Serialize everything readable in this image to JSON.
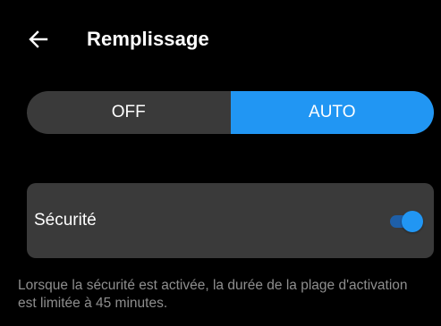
{
  "header": {
    "title": "Remplissage",
    "back_icon": "arrow-left-icon"
  },
  "mode_toggle": {
    "options": [
      {
        "label": "OFF",
        "selected": false
      },
      {
        "label": "AUTO",
        "selected": true
      }
    ],
    "accent_color": "#2196f3"
  },
  "security": {
    "label": "Sécurité",
    "enabled": true,
    "info": "Lorsque la sécurité est activée, la durée de la plage d'activation est limitée à 45 minutes."
  },
  "colors": {
    "background": "#000000",
    "card": "#3a3a3a",
    "accent": "#2196f3",
    "muted_text": "#8e8e8e"
  }
}
